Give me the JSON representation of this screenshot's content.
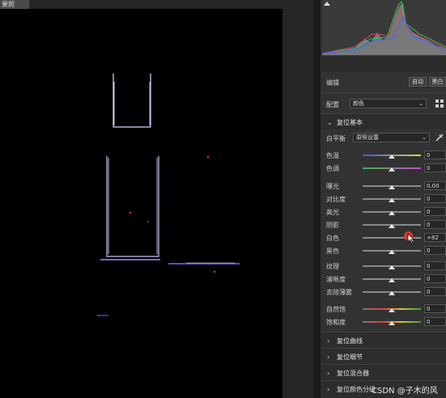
{
  "document_tab": {
    "label": "果照"
  },
  "panel": {
    "edit_title": "编辑",
    "auto_button": "自动",
    "bw_button": "黑白",
    "profile": {
      "label": "配置",
      "value": "颜色"
    },
    "basic": {
      "title": "复位基本",
      "white_balance": {
        "label": "白平衡",
        "value": "原照设置"
      },
      "sliders_group1": [
        {
          "label": "色温",
          "value": "0",
          "position": 0.5,
          "gradient": "temp"
        },
        {
          "label": "色调",
          "value": "0",
          "position": 0.5,
          "gradient": "tint"
        }
      ],
      "sliders_group2": [
        {
          "label": "曝光",
          "value": "0.00",
          "position": 0.5
        },
        {
          "label": "对比度",
          "value": "0",
          "position": 0.5
        },
        {
          "label": "高光",
          "value": "0",
          "position": 0.5
        },
        {
          "label": "阴影",
          "value": "0",
          "position": 0.5
        },
        {
          "label": "白色",
          "value": "+82",
          "position": 0.82
        },
        {
          "label": "黑色",
          "value": "0",
          "position": 0.5
        }
      ],
      "sliders_group3": [
        {
          "label": "纹理",
          "value": "0",
          "position": 0.5
        },
        {
          "label": "清晰度",
          "value": "0",
          "position": 0.5
        },
        {
          "label": "去除薄雾",
          "value": "0",
          "position": 0.5
        }
      ],
      "sliders_group4": [
        {
          "label": "自然饱",
          "value": "0",
          "position": 0.5,
          "gradient": "sat"
        },
        {
          "label": "饱和度",
          "value": "0",
          "position": 0.5,
          "gradient": "sat"
        }
      ]
    },
    "sections": [
      {
        "title": "复位曲线"
      },
      {
        "title": "复位细节"
      },
      {
        "title": "复位混合器"
      },
      {
        "title": "复位颜色分级"
      }
    ]
  },
  "watermark": "CSDN @子木的风",
  "colors": {
    "panel_bg": "#323232",
    "canvas_bg": "#000000",
    "accent_red": "#e0362b"
  }
}
